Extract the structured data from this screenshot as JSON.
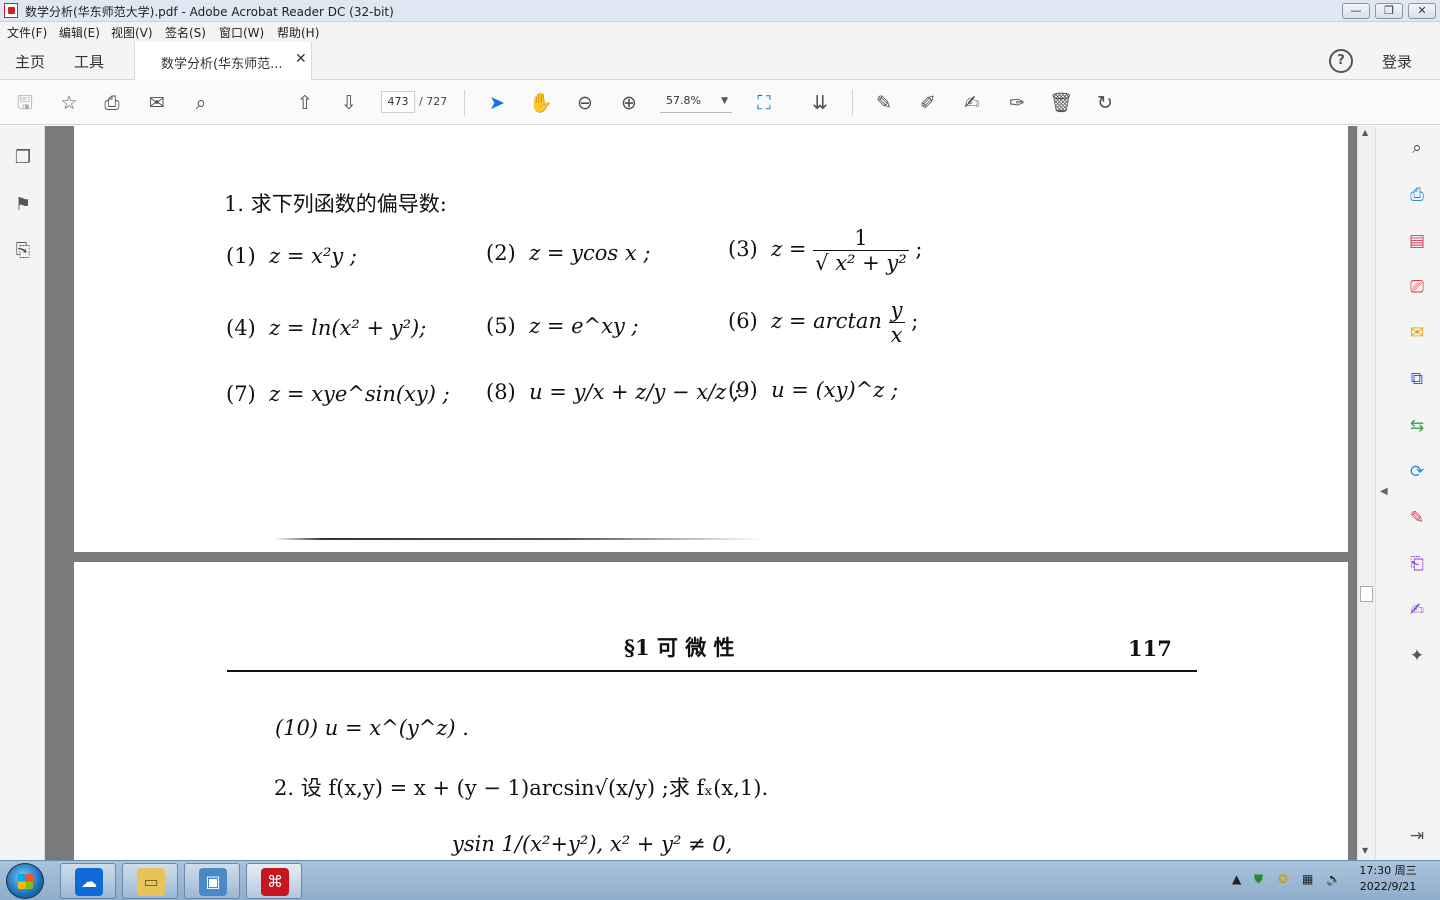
{
  "window": {
    "title": "数学分析(华东师范大学).pdf - Adobe Acrobat Reader DC (32-bit)",
    "controls": [
      "—",
      "❐",
      "✕"
    ]
  },
  "menu": [
    "文件(F)",
    "编辑(E)",
    "视图(V)",
    "签名(S)",
    "窗口(W)",
    "帮助(H)"
  ],
  "tabs": {
    "home": "主页",
    "tools": "工具",
    "document": "数学分析(华东师范...",
    "close": "✕",
    "help": "?",
    "login": "登录"
  },
  "toolbar": {
    "page_current": "473",
    "page_total": "/ 727",
    "zoom": "57.8%"
  },
  "page1": {
    "heading": "1. 求下列函数的偏导数:",
    "items": [
      {
        "label": "(1)",
        "expr": "z = x²y ;"
      },
      {
        "label": "(2)",
        "expr": "z = ycos x ;"
      },
      {
        "label": "(3)",
        "expr_prefix": "z =",
        "numerator": "1",
        "denominator": "√ x² + y²",
        "suffix": ";"
      },
      {
        "label": "(4)",
        "expr": "z = ln(x² + y²);"
      },
      {
        "label": "(5)",
        "expr": "z = e^xy ;"
      },
      {
        "label": "(6)",
        "expr_prefix": "z = arctan",
        "numerator": "y",
        "denominator": "x",
        "suffix": ";"
      },
      {
        "label": "(7)",
        "expr": "z = xye^sin(xy) ;"
      },
      {
        "label": "(8)",
        "expr": "u = y/x + z/y − x/z ;"
      },
      {
        "label": "(9)",
        "expr": "u = (xy)^z ;"
      }
    ]
  },
  "page2": {
    "header_section": "§1  可  微  性",
    "page_number": "117",
    "item10": "(10)  u = x^(y^z) .",
    "problem2": "2. 设 f(x,y) = x + (y − 1)arcsin√(x/y) ;求 fₓ(x,1).",
    "problem3_partial": "ysin 1/(x²+y²),   x² + y² ≠ 0,"
  },
  "taskbar": {
    "time": "17:30 周三",
    "date": "2022/9/21"
  }
}
